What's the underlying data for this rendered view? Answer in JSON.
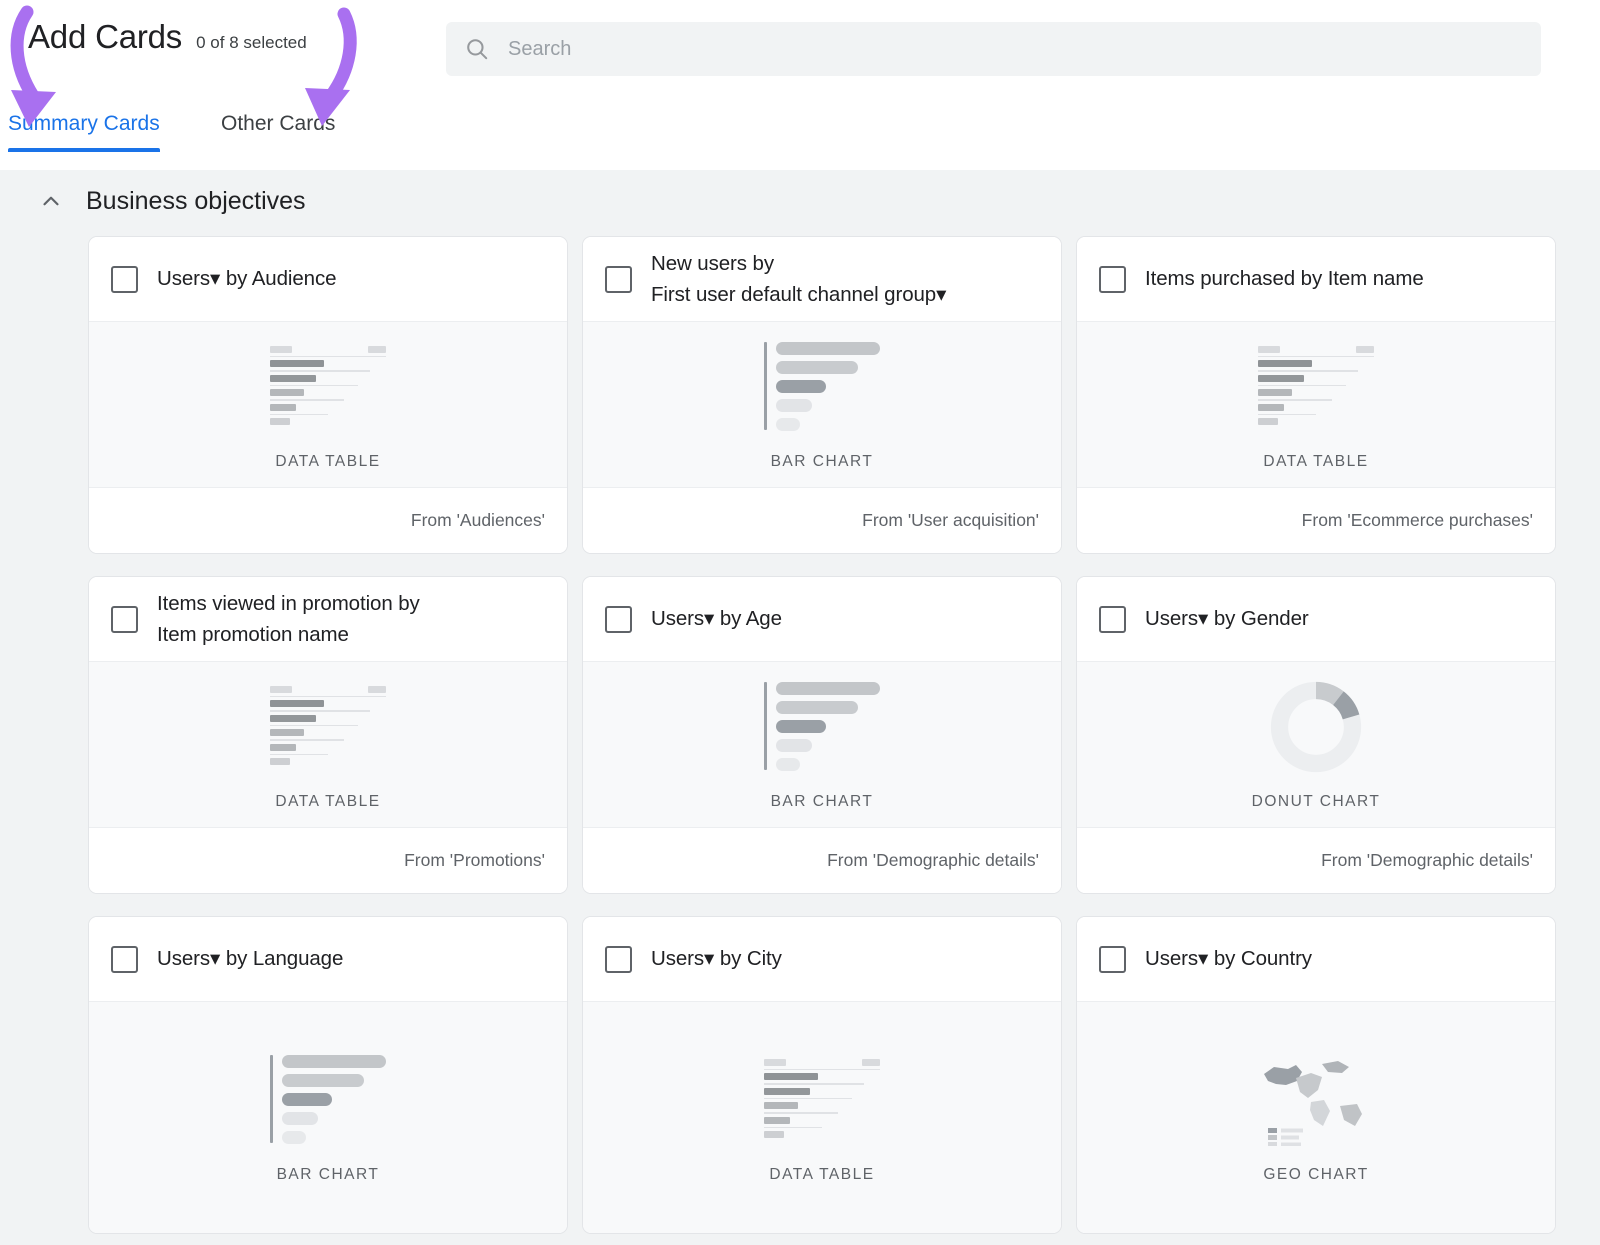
{
  "header": {
    "title": "Add Cards",
    "selected_count": "0 of 8 selected",
    "search_placeholder": "Search",
    "search_value": "",
    "search_icon": "search-icon"
  },
  "tabs": [
    {
      "label": "Summary Cards",
      "active": true
    },
    {
      "label": "Other Cards",
      "active": false
    }
  ],
  "section": {
    "title": "Business objectives",
    "collapse_icon": "chevron-up-icon",
    "expanded": true
  },
  "colors": {
    "accent_blue": "#1a73e8",
    "annotation_purple": "#a970f0",
    "page_background": "#f1f3f4",
    "card_background": "#ffffff",
    "preview_background": "#f8f9fa",
    "text_primary": "#202124",
    "text_secondary": "#5f6368"
  },
  "cards": [
    {
      "title_prefix": "Users",
      "has_dropdown": true,
      "title_suffix": " by Audience",
      "title_lines": [
        "Users▾ by Audience"
      ],
      "preview_type": "data-table",
      "type_label": "DATA TABLE",
      "source": "From 'Audiences'",
      "checked": false
    },
    {
      "title_prefix": "New users by First user default channel group",
      "has_dropdown": true,
      "title_suffix": "",
      "title_lines": [
        "New users by",
        "First user default channel group▾"
      ],
      "preview_type": "bar-chart",
      "type_label": "BAR CHART",
      "source": "From 'User acquisition'",
      "checked": false
    },
    {
      "title_prefix": "Items purchased by Item name",
      "has_dropdown": false,
      "title_suffix": "",
      "title_lines": [
        "Items purchased by Item name"
      ],
      "preview_type": "data-table",
      "type_label": "DATA TABLE",
      "source": "From 'Ecommerce purchases'",
      "checked": false
    },
    {
      "title_prefix": "Items viewed in promotion by Item promotion name",
      "has_dropdown": false,
      "title_suffix": "",
      "title_lines": [
        "Items viewed in promotion by",
        "Item promotion name"
      ],
      "preview_type": "data-table",
      "type_label": "DATA TABLE",
      "source": "From 'Promotions'",
      "checked": false
    },
    {
      "title_prefix": "Users",
      "has_dropdown": true,
      "title_suffix": " by Age",
      "title_lines": [
        "Users▾ by Age"
      ],
      "preview_type": "bar-chart",
      "type_label": "BAR CHART",
      "source": "From 'Demographic details'",
      "checked": false
    },
    {
      "title_prefix": "Users",
      "has_dropdown": true,
      "title_suffix": " by Gender",
      "title_lines": [
        "Users▾ by Gender"
      ],
      "preview_type": "donut-chart",
      "type_label": "DONUT CHART",
      "source": "From 'Demographic details'",
      "checked": false
    },
    {
      "title_prefix": "Users",
      "has_dropdown": true,
      "title_suffix": " by Language",
      "title_lines": [
        "Users▾ by Language"
      ],
      "preview_type": "bar-chart",
      "type_label": "BAR CHART",
      "source": "",
      "checked": false
    },
    {
      "title_prefix": "Users",
      "has_dropdown": true,
      "title_suffix": " by City",
      "title_lines": [
        "Users▾ by City"
      ],
      "preview_type": "data-table",
      "type_label": "DATA TABLE",
      "source": "",
      "checked": false
    },
    {
      "title_prefix": "Users",
      "has_dropdown": true,
      "title_suffix": " by Country",
      "title_lines": [
        "Users▾ by Country"
      ],
      "preview_type": "geo-chart",
      "type_label": "GEO CHART",
      "source": "",
      "checked": false
    }
  ],
  "annotations": [
    {
      "name": "arrow-to-summary-cards-tab",
      "color": "#a970f0"
    },
    {
      "name": "arrow-to-other-cards-tab",
      "color": "#a970f0"
    }
  ]
}
